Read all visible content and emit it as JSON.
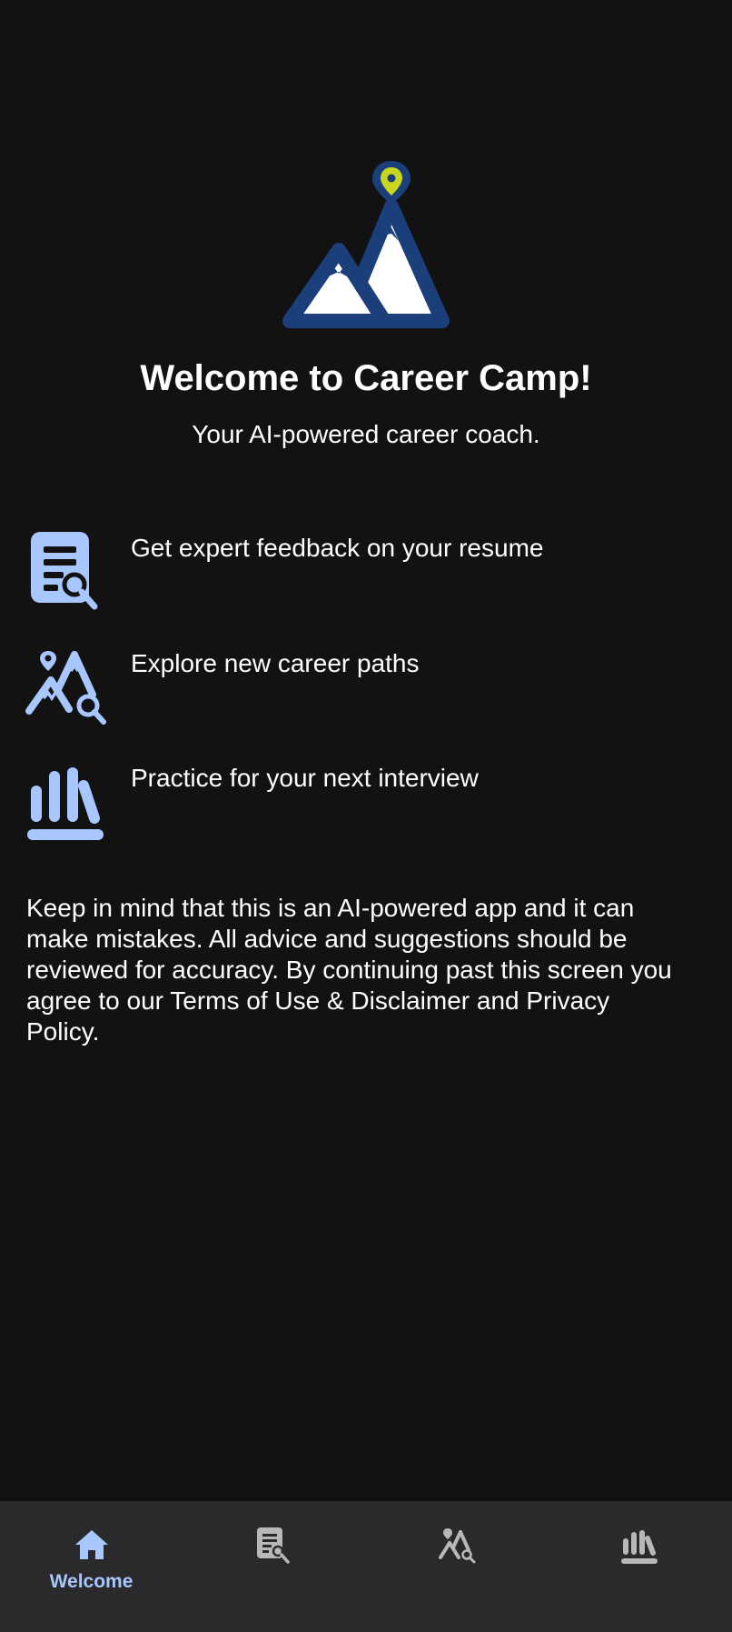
{
  "welcome": {
    "title": "Welcome to Career Camp!",
    "subtitle": "Your AI-powered career coach."
  },
  "features": [
    {
      "icon": "resume-review-icon",
      "label": "Get expert feedback on your resume"
    },
    {
      "icon": "career-explore-icon",
      "label": "Explore new career paths"
    },
    {
      "icon": "interview-practice-icon",
      "label": "Practice for your next interview"
    }
  ],
  "disclaimer": "Keep in mind that this is an AI-powered app and it can make mistakes. All advice and suggestions should be reviewed for accuracy. By continuing past this screen you agree to our Terms of Use & Disclaimer and Privacy Policy.",
  "nav": {
    "items": [
      {
        "icon": "home-icon",
        "label": "Welcome",
        "active": true
      },
      {
        "icon": "resume-icon",
        "label": "",
        "active": false
      },
      {
        "icon": "career-paths-icon",
        "label": "",
        "active": false
      },
      {
        "icon": "interview-icon",
        "label": "",
        "active": false
      }
    ]
  },
  "colors": {
    "background": "#121213",
    "navbar": "#2a2a2c",
    "accent": "#a9c7ff",
    "inactive_icon": "#b8b8b8",
    "logo_blue": "#1a3f7a",
    "logo_pin": "#c8d61e"
  }
}
